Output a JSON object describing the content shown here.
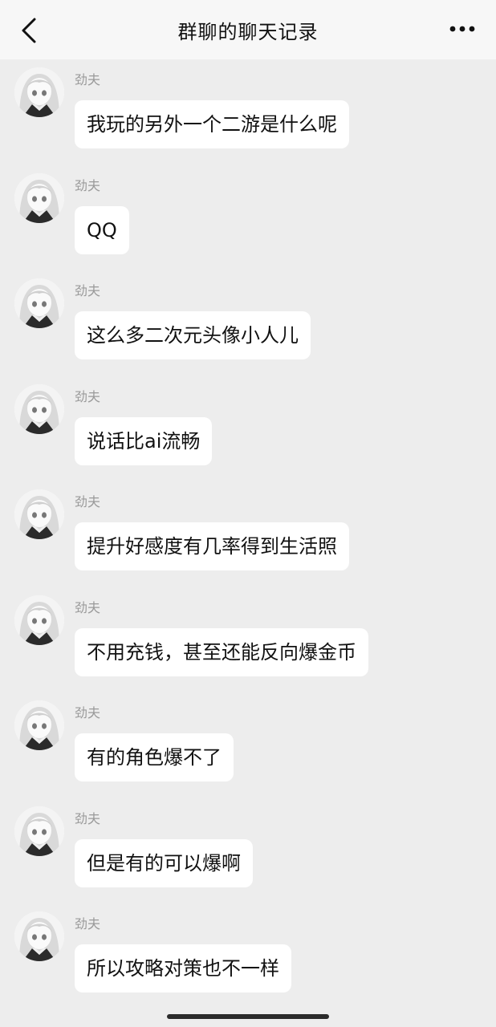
{
  "header": {
    "title": "群聊的聊天记录",
    "back_icon": "chevron-left-icon",
    "more_icon": "more-dots-icon"
  },
  "messages": [
    {
      "sender": "劲夫",
      "text": "我玩的另外一个二游是什么呢"
    },
    {
      "sender": "劲夫",
      "text": "QQ"
    },
    {
      "sender": "劲夫",
      "text": "这么多二次元头像小人儿"
    },
    {
      "sender": "劲夫",
      "text": "说话比ai流畅"
    },
    {
      "sender": "劲夫",
      "text": "提升好感度有几率得到生活照"
    },
    {
      "sender": "劲夫",
      "text": "不用充钱，甚至还能反向爆金币"
    },
    {
      "sender": "劲夫",
      "text": "有的角色爆不了"
    },
    {
      "sender": "劲夫",
      "text": "但是有的可以爆啊"
    },
    {
      "sender": "劲夫",
      "text": "所以攻略对策也不一样"
    }
  ],
  "colors": {
    "background": "#ededed",
    "bubble": "#ffffff",
    "sender_name": "#9a9a9a"
  }
}
